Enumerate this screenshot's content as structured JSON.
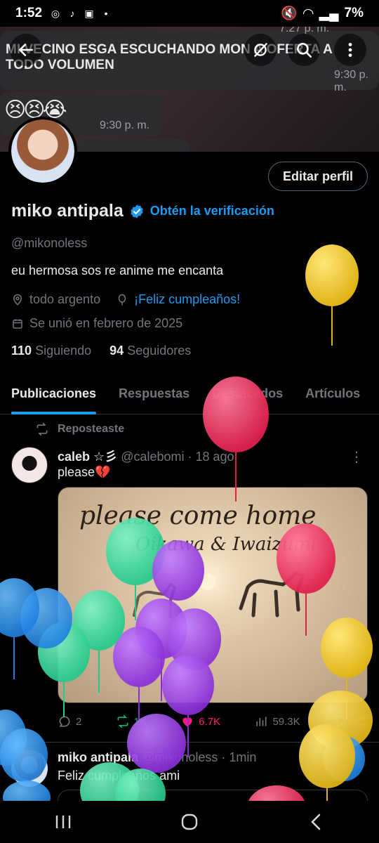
{
  "status_bar": {
    "time": "1:52",
    "battery": "7%"
  },
  "banner": {
    "message": "MI VECINO ESGA ESCUCHANDO MON A OFERTA A TODO VOLUMEN",
    "message_time": "9:30 p. m.",
    "emojis": "😣😣😭",
    "emoji_time": "9:30 p. m.",
    "top_time": "7:27 p. m."
  },
  "header": {
    "edit_profile": "Editar perfil"
  },
  "profile": {
    "name": "miko antipala",
    "verify_link": "Obtén la verificación",
    "handle": "@mikonoless",
    "bio": "eu hermosa sos re anime me encanta",
    "location": "todo argento",
    "birthday": "¡Feliz cumpleaños!",
    "joined": "Se unió en febrero de 2025",
    "following_count": "110",
    "following_label": "Siguiendo",
    "followers_count": "94",
    "followers_label": "Seguidores"
  },
  "tabs": [
    {
      "label": "Publicaciones"
    },
    {
      "label": "Respuestas"
    },
    {
      "label": "Destacados"
    },
    {
      "label": "Artículos"
    }
  ],
  "post": {
    "repost_label": "Reposteaste",
    "author": "caleb ☆彡",
    "handle_time": "@calebomi · 18 ago",
    "text": "please💔",
    "media_title": "please come home",
    "media_subtitle": "Oikawa & Iwaizumi",
    "replies": "2",
    "reposts": "1K",
    "likes": "6.7K",
    "views": "59.3K"
  },
  "post2": {
    "author": "miko antipala",
    "handle_time": "@mikonoless · 1min",
    "text": "Feliz cumpleaños ami"
  },
  "colors": {
    "accent": "#1d9bf0",
    "like": "#f91880",
    "background": "#000000",
    "balloon_yellow": "#e8c01e",
    "balloon_red": "#e8305e",
    "balloon_green": "#2fd69a",
    "balloon_purple": "#9a3be0",
    "balloon_blue": "#2a8ee8"
  }
}
